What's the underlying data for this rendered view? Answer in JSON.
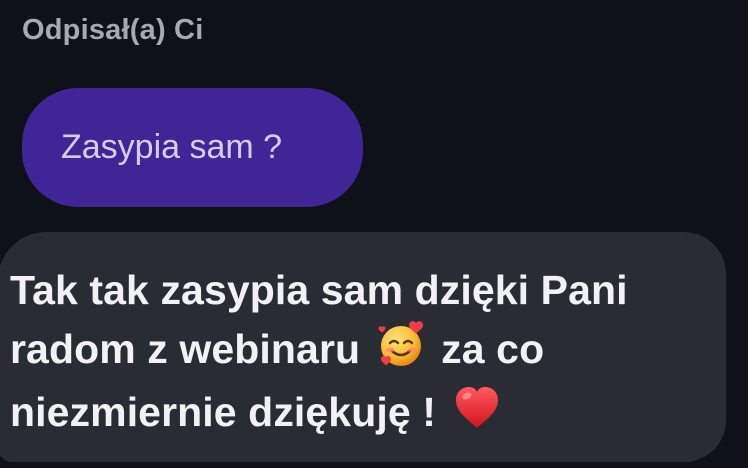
{
  "reply_label": "Odpisał(a) Ci",
  "quoted_message": {
    "text": "Zasypia sam ?"
  },
  "reply_message": {
    "line1": "Tak tak zasypia sam dzięki Pani",
    "line2_before_emoji": "radom z webinaru",
    "emoji_1": "smiling-face-with-hearts-icon",
    "line2_after_emoji": "za co",
    "line3_before_emoji": "niezmiernie dziękuję !",
    "emoji_2": "red-heart-icon"
  },
  "colors": {
    "background": "#0f1118",
    "quoted_bubble": "#3f2596",
    "reply_bubble": "#2a2c33",
    "label": "#a7a9b0",
    "heart": "#e5252a"
  }
}
